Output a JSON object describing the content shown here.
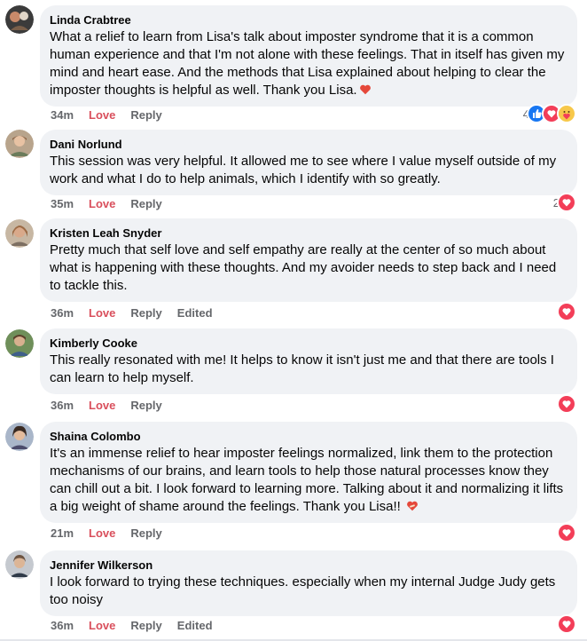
{
  "comments": [
    {
      "author": "Linda Crabtree",
      "text": "What a relief to learn from Lisa's talk about imposter syndrome that it is a common human experience and that I'm not alone with these feelings. That in itself has given my mind and heart ease. And the methods that Lisa explained about helping to clear the imposter thoughts is helpful as well. Thank you Lisa.",
      "inline_emoji": "heart",
      "time": "34m",
      "love": "Love",
      "reply": "Reply",
      "edited": "",
      "reaction_count": "4",
      "reactions": [
        "like",
        "love",
        "care"
      ]
    },
    {
      "author": "Dani Norlund",
      "text": "This session was very helpful. It allowed me to see where I value myself outside of my work and what I do to help animals, which I identify with so greatly.",
      "time": "35m",
      "love": "Love",
      "reply": "Reply",
      "edited": "",
      "reaction_count": "2",
      "reactions": [
        "love"
      ]
    },
    {
      "author": "Kristen Leah Snyder",
      "text": "Pretty much that self love and self empathy are really at the center of so much about what is happening with these thoughts. And my avoider needs to step back and I need to tackle this.",
      "time": "36m",
      "love": "Love",
      "reply": "Reply",
      "edited": "Edited",
      "reaction_count": "",
      "reactions": [
        "love"
      ]
    },
    {
      "author": "Kimberly Cooke",
      "text": "This really resonated with me! It helps to know it isn't just me and that there are tools I can learn to help myself.",
      "time": "36m",
      "love": "Love",
      "reply": "Reply",
      "edited": "",
      "reaction_count": "",
      "reactions": [
        "love"
      ]
    },
    {
      "author": "Shaina Colombo",
      "text": "It's an immense relief to hear imposter feelings normalized, link them to the protection mechanisms of our brains, and learn tools to help those natural processes know they can chill out a bit. I look forward to learning more. Talking about it and normalizing it lifts a big weight of shame around the feelings. Thank you Lisa!!",
      "inline_emoji": "mending-heart",
      "time": "21m",
      "love": "Love",
      "reply": "Reply",
      "edited": "",
      "reaction_count": "",
      "reactions": [
        "love"
      ]
    },
    {
      "author": "Jennifer Wilkerson",
      "text": "I look forward to trying these techniques. especially when my internal Judge Judy gets too noisy",
      "time": "36m",
      "love": "Love",
      "reply": "Reply",
      "edited": "Edited",
      "reaction_count": "",
      "reactions": [
        "love"
      ]
    }
  ],
  "colors": {
    "love_action": "#d94f5c",
    "bubble": "#f0f2f5",
    "meta": "#65676b",
    "like_blue": "#1877f2",
    "love_red": "#f33e58"
  }
}
